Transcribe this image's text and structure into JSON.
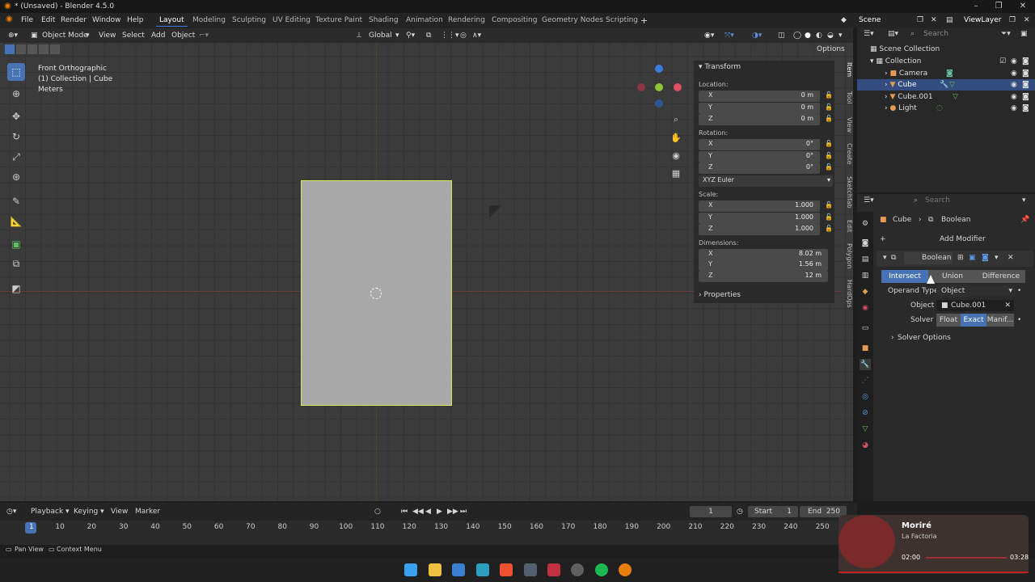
{
  "app": {
    "title": "* (Unsaved) - Blender 4.5.0"
  },
  "menu": {
    "file": "File",
    "edit": "Edit",
    "render": "Render",
    "window": "Window",
    "help": "Help"
  },
  "workspaces": [
    "Layout",
    "Modeling",
    "Sculpting",
    "UV Editing",
    "Texture Paint",
    "Shading",
    "Animation",
    "Rendering",
    "Compositing",
    "Geometry Nodes",
    "Scripting"
  ],
  "scene": {
    "name": "Scene",
    "view_layer": "ViewLayer"
  },
  "viewport_header": {
    "mode": "Object Mode",
    "view": "View",
    "select": "Select",
    "add": "Add",
    "object": "Object",
    "orientation": "Global",
    "options": "Options"
  },
  "viewport_info": {
    "line1": "Front Orthographic",
    "line2": "(1) Collection | Cube",
    "line3": "Meters"
  },
  "gizmo": {
    "x": "X",
    "y": "Y",
    "z": "Z"
  },
  "npanel": {
    "header": "Transform",
    "location": "Location:",
    "rotation": "Rotation:",
    "scale": "Scale:",
    "dimensions": "Dimensions:",
    "rotation_mode": "XYZ Euler",
    "properties": "Properties",
    "loc": [
      {
        "k": "X",
        "v": "0 m"
      },
      {
        "k": "Y",
        "v": "0 m"
      },
      {
        "k": "Z",
        "v": "0 m"
      }
    ],
    "rot": [
      {
        "k": "X",
        "v": "0°"
      },
      {
        "k": "Y",
        "v": "0°"
      },
      {
        "k": "Z",
        "v": "0°"
      }
    ],
    "scl": [
      {
        "k": "X",
        "v": "1.000"
      },
      {
        "k": "Y",
        "v": "1.000"
      },
      {
        "k": "Z",
        "v": "1.000"
      }
    ],
    "dim": [
      {
        "k": "X",
        "v": "8.02 m"
      },
      {
        "k": "Y",
        "v": "1.56 m"
      },
      {
        "k": "Z",
        "v": "12 m"
      }
    ]
  },
  "side_tabs": [
    "Item",
    "Tool",
    "View",
    "Create",
    "Sketchfab",
    "Edit",
    "Polygon",
    "HardOps"
  ],
  "outliner": {
    "search": "Search",
    "root": "Scene Collection",
    "collection": "Collection",
    "items": [
      "Camera",
      "Cube",
      "Cube.001",
      "Light"
    ]
  },
  "properties": {
    "search": "Search",
    "breadcrumb_obj": "Cube",
    "breadcrumb_mod": "Boolean",
    "add_modifier": "Add Modifier",
    "modifier_name": "Boolean",
    "op_intersect": "Intersect",
    "op_union": "Union",
    "op_difference": "Difference",
    "operand_type_label": "Operand Type",
    "operand_type": "Object",
    "object_label": "Object",
    "object_value": "Cube.001",
    "solver_label": "Solver",
    "solver_float": "Float",
    "solver_exact": "Exact",
    "solver_manifold": "Manif...",
    "solver_options": "Solver Options"
  },
  "timeline": {
    "playback": "Playback",
    "keying": "Keying",
    "view": "View",
    "marker": "Marker",
    "current": "1",
    "start_label": "Start",
    "start": "1",
    "end_label": "End",
    "end": "250",
    "ticks": [
      "1",
      "10",
      "20",
      "30",
      "40",
      "50",
      "60",
      "70",
      "80",
      "90",
      "100",
      "110",
      "120",
      "130",
      "140",
      "150",
      "160",
      "170",
      "180",
      "190",
      "200",
      "210",
      "220",
      "230",
      "240",
      "250"
    ]
  },
  "status": {
    "pan": "Pan View",
    "context": "Context Menu"
  },
  "music": {
    "title": "Moriré",
    "artist": "La Factoria",
    "elapsed": "02:00",
    "total": "03:28"
  }
}
